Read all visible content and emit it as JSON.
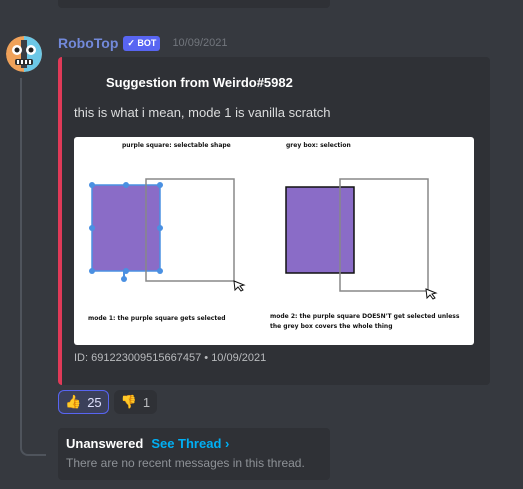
{
  "message": {
    "username": "RoboTop",
    "bot_tag": "✓ BOT",
    "timestamp": "10/09/2021",
    "avatar_icon": "robot-face-icon"
  },
  "embed": {
    "accent_color": "#e03a58",
    "title": "Suggestion from Weirdo#5982",
    "description": "this is what i mean, mode 1 is vanilla scratch",
    "footer": "ID: 691223009515667457 • 10/09/2021",
    "image": {
      "label_left_top": "purple square: selectable shape",
      "label_right_top": "grey box: selection",
      "caption_mode1": "mode 1: the purple square gets selected",
      "caption_mode2_line1": "mode 2: the purple square DOESN'T get selected unless",
      "caption_mode2_line2": "the grey box covers the whole thing"
    }
  },
  "reactions": [
    {
      "emoji": "👍",
      "count": "25",
      "active": true,
      "icon": "thumbs-up-icon"
    },
    {
      "emoji": "👎",
      "count": "1",
      "active": false,
      "icon": "thumbs-down-icon"
    }
  ],
  "thread": {
    "status": "Unanswered",
    "link_label": "See Thread ›",
    "empty_text": "There are no recent messages in this thread."
  }
}
